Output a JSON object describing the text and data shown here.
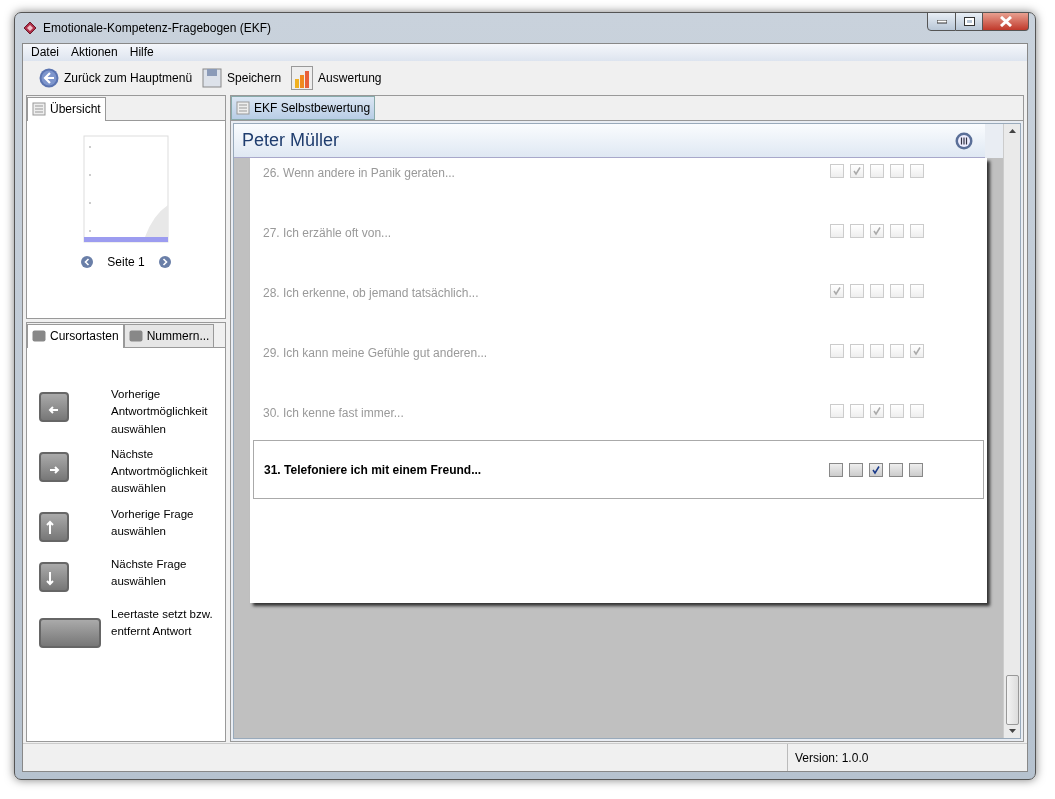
{
  "window": {
    "title": "Emotionale-Kompetenz-Fragebogen (EKF)"
  },
  "menu": [
    "Datei",
    "Aktionen",
    "Hilfe"
  ],
  "toolbar": [
    {
      "kind": "back",
      "label": "Zurück zum Hauptmenü"
    },
    {
      "kind": "save",
      "label": "Speichern"
    },
    {
      "kind": "chart",
      "label": "Auswertung"
    }
  ],
  "overview": {
    "tab": "Übersicht",
    "page_label": "Seite 1"
  },
  "legend": {
    "tabs": [
      {
        "label": "Cursortasten",
        "selected": true
      },
      {
        "label": "Nummern...",
        "selected": false
      }
    ],
    "items": [
      {
        "kind": "left",
        "text": "Vorherige Antwortmöglichkeit auswählen"
      },
      {
        "kind": "right",
        "text": "Nächste Antwortmöglichkeit auswählen"
      },
      {
        "kind": "up",
        "text": "Vorherige Frage auswählen"
      },
      {
        "kind": "down",
        "text": "Nächste Frage auswählen"
      },
      {
        "kind": "space",
        "text": "Leertaste setzt bzw. entfernt Antwort"
      }
    ]
  },
  "document": {
    "tab": "EKF Selbstbewertung",
    "person": "Peter Müller",
    "questions": [
      {
        "text": "26. Wenn andere in Panik geraten...",
        "active": false,
        "answers": [
          false,
          true,
          false,
          false,
          false
        ]
      },
      {
        "text": "27. Ich erzähle oft von...",
        "active": false,
        "answers": [
          false,
          false,
          true,
          false,
          false
        ]
      },
      {
        "text": "28. Ich erkenne, ob jemand tatsächlich...",
        "active": false,
        "answers": [
          true,
          false,
          false,
          false,
          false
        ]
      },
      {
        "text": "29. Ich kann meine Gefühle gut anderen...",
        "active": false,
        "answers": [
          false,
          false,
          false,
          false,
          true
        ]
      },
      {
        "text": "30. Ich kenne fast immer...",
        "active": false,
        "answers": [
          false,
          false,
          true,
          false,
          false
        ]
      },
      {
        "text": "31. Telefoniere ich mit einem Freund...",
        "active": true,
        "answers": [
          false,
          false,
          true,
          false,
          false
        ]
      }
    ]
  },
  "status_bar": {
    "version": "Version: 1.0.0"
  }
}
